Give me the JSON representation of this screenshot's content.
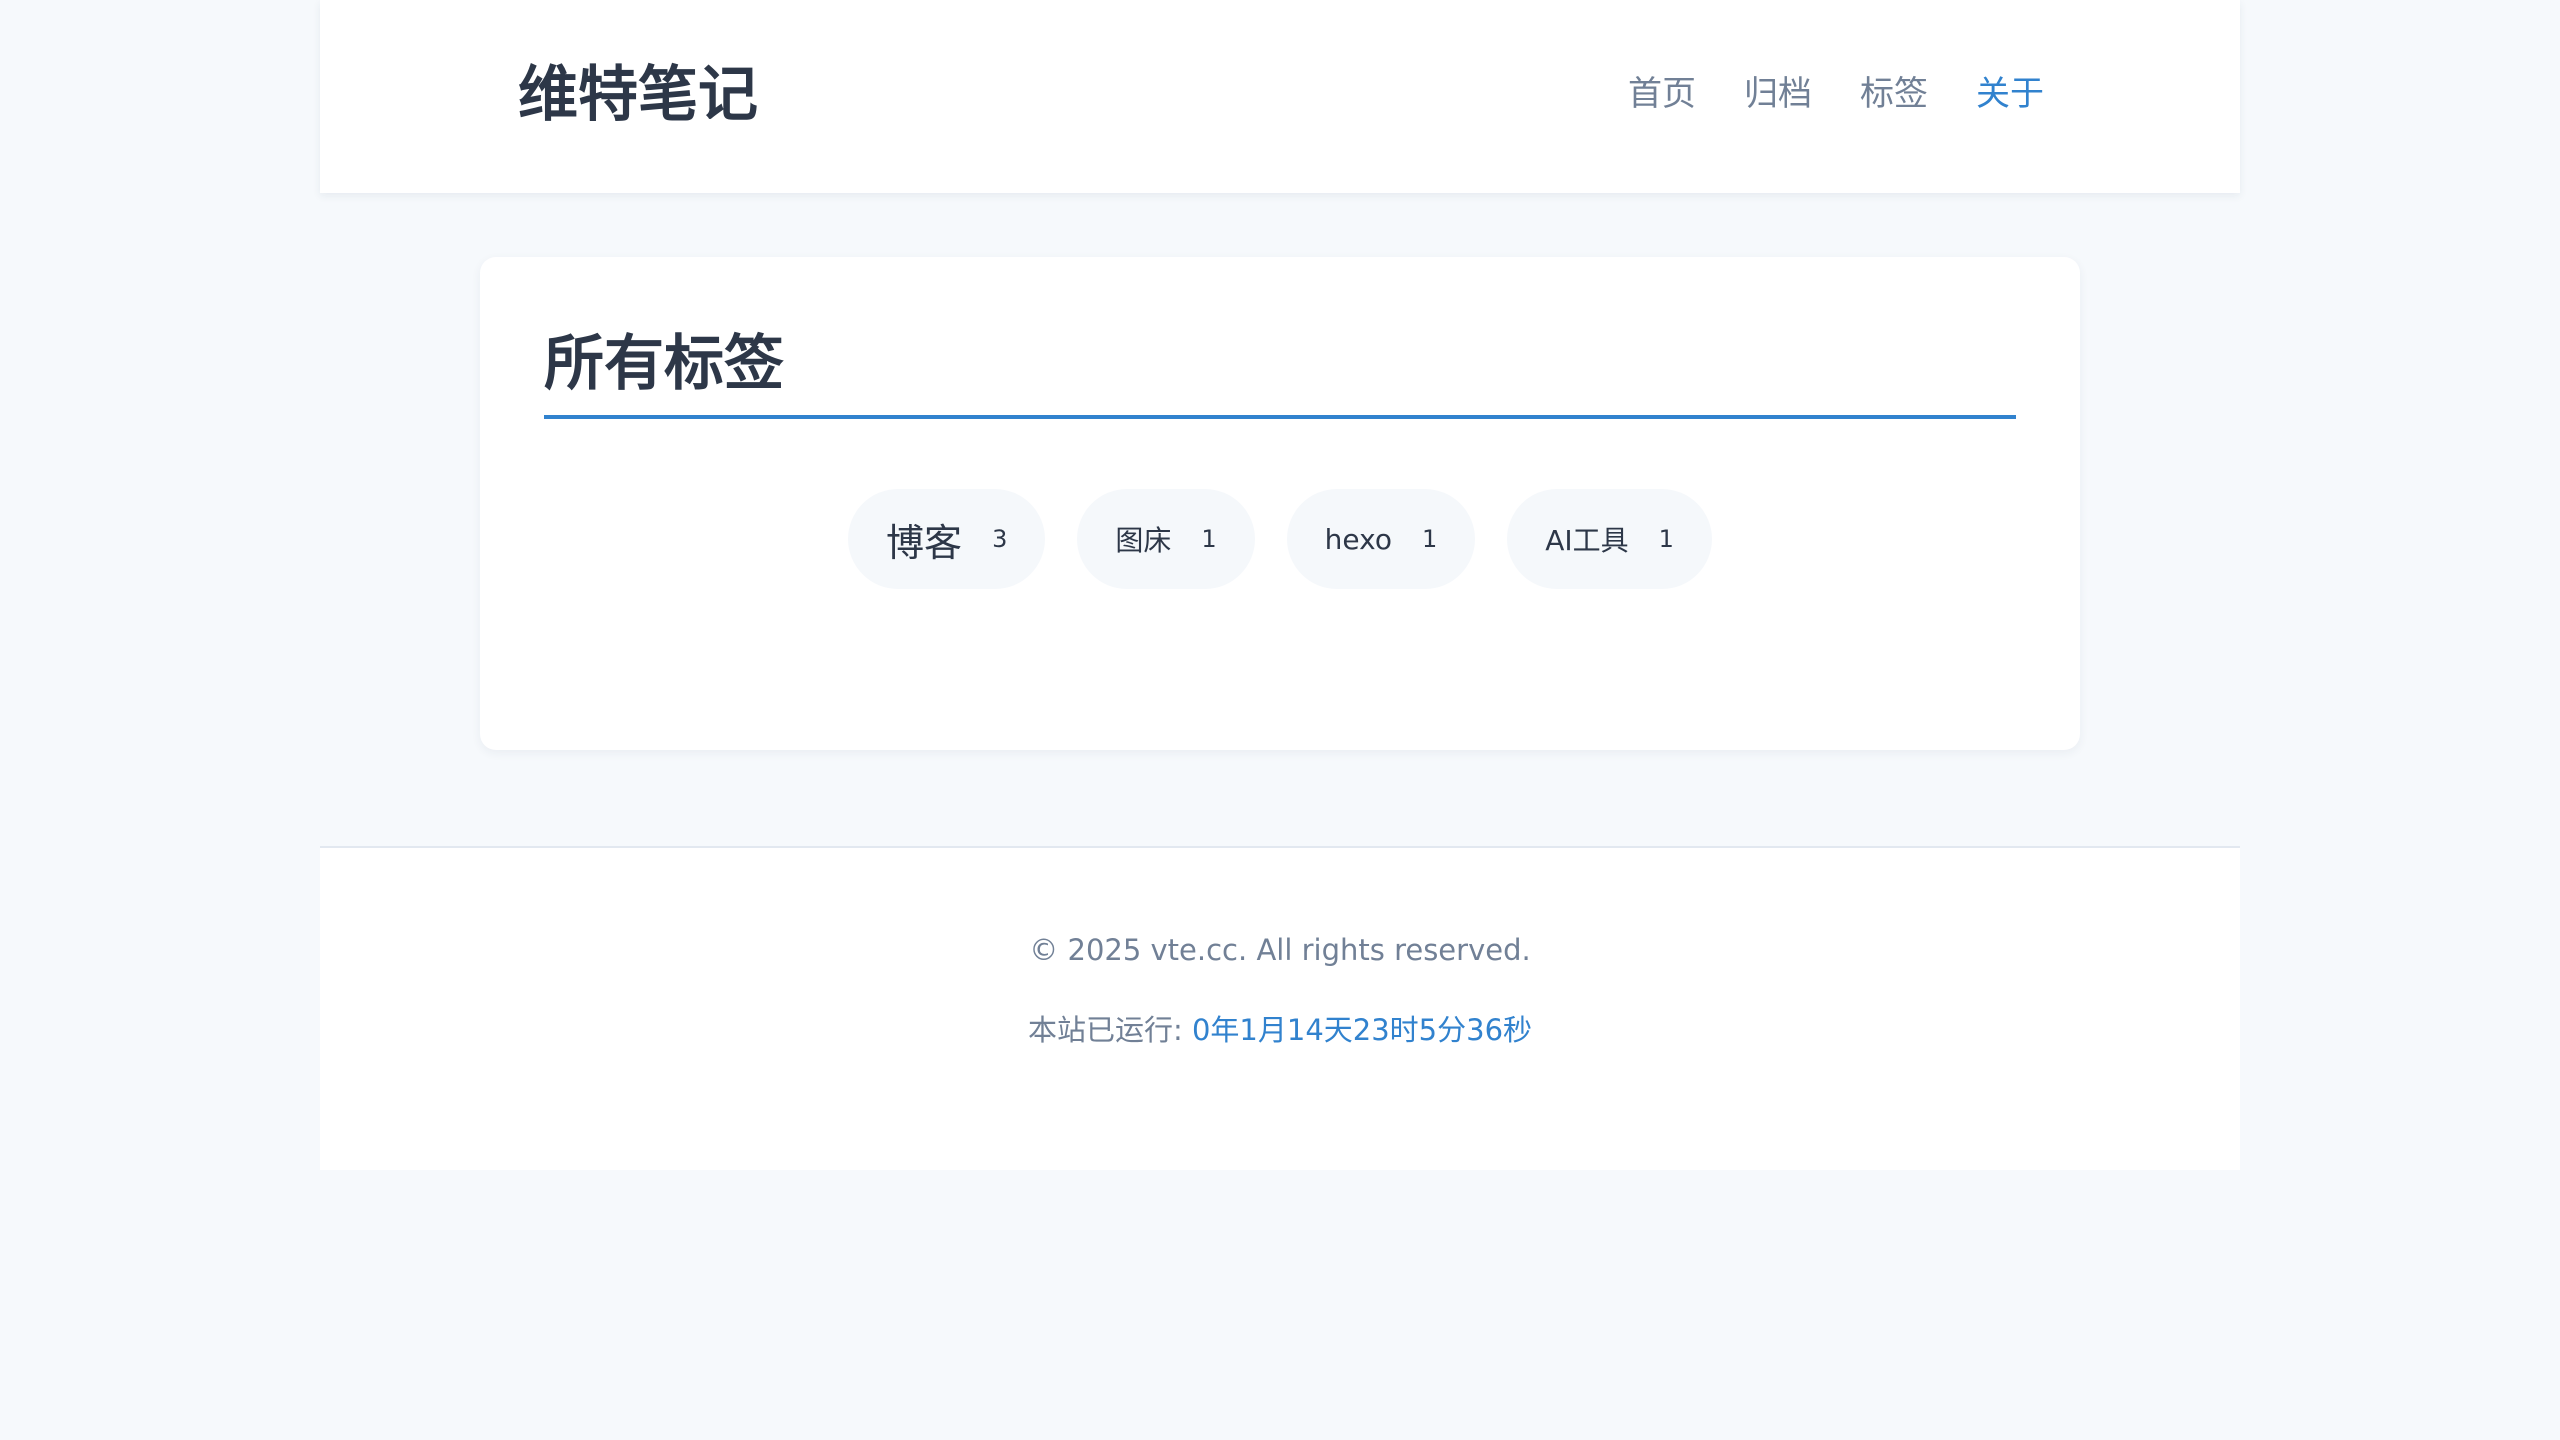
{
  "header": {
    "site_title": "维特笔记",
    "nav": [
      {
        "label": "首页",
        "active": false
      },
      {
        "label": "归档",
        "active": false
      },
      {
        "label": "标签",
        "active": false
      },
      {
        "label": "关于",
        "active": true
      }
    ]
  },
  "main": {
    "page_title": "所有标签",
    "tags": [
      {
        "name": "博客",
        "count": "3"
      },
      {
        "name": "图床",
        "count": "1"
      },
      {
        "name": "hexo",
        "count": "1"
      },
      {
        "name": "AI工具",
        "count": "1"
      }
    ]
  },
  "footer": {
    "copyright": "© 2025 vte.cc. All rights reserved.",
    "uptime_label": "本站已运行: ",
    "uptime_value": "0年1月14天23时5分36秒"
  },
  "colors": {
    "accent": "#3182ce",
    "text": "#2d3748",
    "muted": "#718096",
    "page_background": "#f6f9fc",
    "chip_background": "#f5f8fb"
  }
}
